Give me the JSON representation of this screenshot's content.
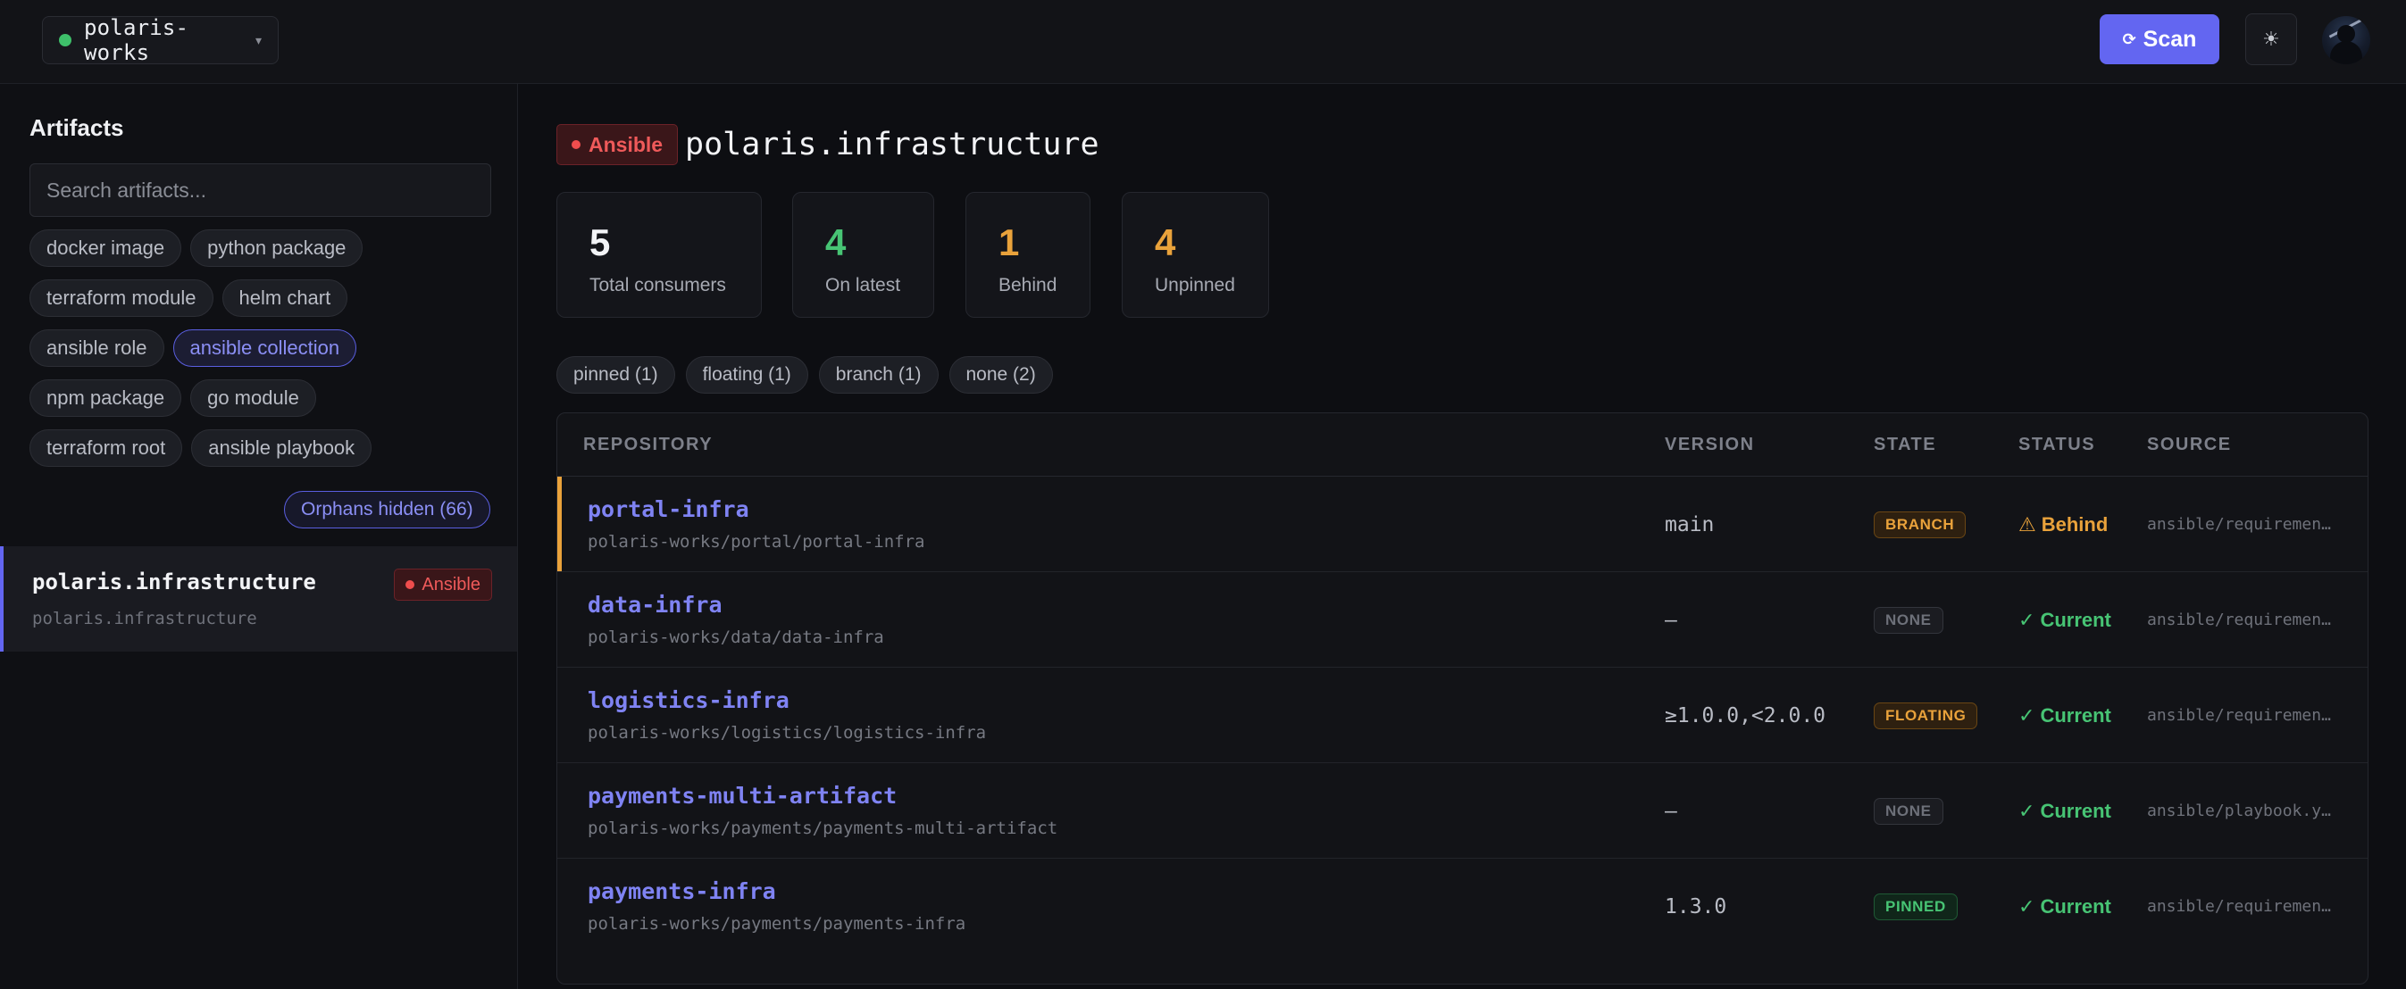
{
  "topbar": {
    "org_name": "polaris-works",
    "org_status_color": "#3ec06a",
    "caret_icon": "▾",
    "scan_icon": "⟳",
    "scan_label": "Scan",
    "theme_icon": "☀"
  },
  "sidebar": {
    "title": "Artifacts",
    "search_placeholder": "Search artifacts...",
    "type_filters": [
      [
        "docker image",
        "python package"
      ],
      [
        "terraform module",
        "helm chart"
      ],
      [
        "ansible role",
        "ansible collection"
      ],
      [
        "npm package",
        "go module"
      ],
      [
        "terraform root",
        "ansible playbook"
      ]
    ],
    "active_filter": "ansible collection",
    "orphans_label": "Orphans hidden (66)",
    "selected_artifact": {
      "name": "polaris.infrastructure",
      "subtitle": "polaris.infrastructure",
      "badge": "Ansible"
    }
  },
  "main": {
    "kind_badge": "Ansible",
    "title": "polaris.infrastructure",
    "stats": [
      {
        "value": "5",
        "label": "Total consumers",
        "color": "#f2f3f6"
      },
      {
        "value": "4",
        "label": "On latest",
        "color": "#47c474"
      },
      {
        "value": "1",
        "label": "Behind",
        "color": "#e9a23b"
      },
      {
        "value": "4",
        "label": "Unpinned",
        "color": "#e9a23b"
      }
    ],
    "pin_filters": [
      "pinned (1)",
      "floating (1)",
      "branch (1)",
      "none (2)"
    ],
    "table": {
      "headers": {
        "repository": "REPOSITORY",
        "version": "VERSION",
        "state": "STATE",
        "status": "STATUS",
        "source": "SOURCE"
      },
      "rows": [
        {
          "name": "portal-infra",
          "path": "polaris-works/portal/portal-infra",
          "version": "main",
          "state": "BRANCH",
          "status_icon": "⚠",
          "status": "Behind",
          "source": "ansible/requiremen…"
        },
        {
          "name": "data-infra",
          "path": "polaris-works/data/data-infra",
          "version": "—",
          "state": "NONE",
          "status_icon": "✓",
          "status": "Current",
          "source": "ansible/requiremen…"
        },
        {
          "name": "logistics-infra",
          "path": "polaris-works/logistics/logistics-infra",
          "version": "≥1.0.0,<2.0.0",
          "state": "FLOATING",
          "status_icon": "✓",
          "status": "Current",
          "source": "ansible/requiremen…"
        },
        {
          "name": "payments-multi-artifact",
          "path": "polaris-works/payments/payments-multi-artifact",
          "version": "—",
          "state": "NONE",
          "status_icon": "✓",
          "status": "Current",
          "source": "ansible/playbook.y…"
        },
        {
          "name": "payments-infra",
          "path": "polaris-works/payments/payments-infra",
          "version": "1.3.0",
          "state": "PINNED",
          "status_icon": "✓",
          "status": "Current",
          "source": "ansible/requiremen…"
        }
      ]
    }
  }
}
